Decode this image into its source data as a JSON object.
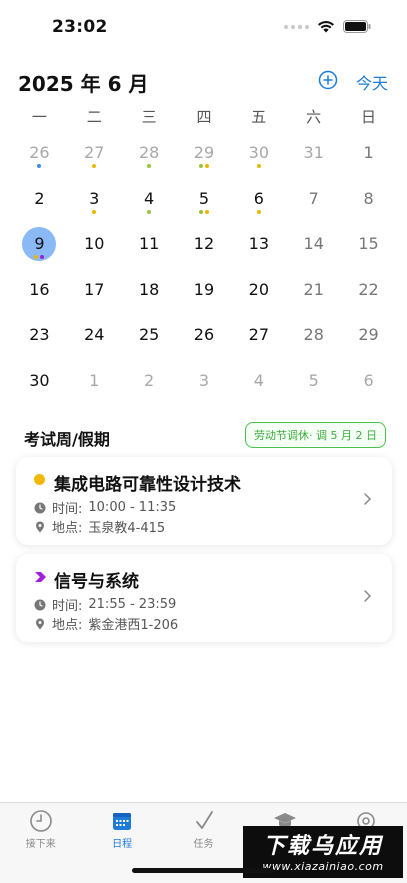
{
  "status_bar": {
    "time": "23:02"
  },
  "header": {
    "month_title": "2025 年 6 月",
    "today_label": "今天"
  },
  "weekdays": [
    "一",
    "二",
    "三",
    "四",
    "五",
    "六",
    "日"
  ],
  "calendar": {
    "selected_day": "9",
    "days": [
      {
        "d": "26",
        "other": true,
        "dots": [
          "#3a8ee6"
        ]
      },
      {
        "d": "27",
        "other": true,
        "dots": [
          "#e8b800"
        ]
      },
      {
        "d": "28",
        "other": true,
        "dots": [
          "#9bc23a"
        ]
      },
      {
        "d": "29",
        "other": true,
        "dots": [
          "#9bc23a",
          "#e8b800"
        ]
      },
      {
        "d": "30",
        "other": true,
        "dots": [
          "#e8b800"
        ]
      },
      {
        "d": "31",
        "other": true,
        "dots": []
      },
      {
        "d": "1",
        "other": false,
        "weekend": true,
        "dots": []
      },
      {
        "d": "2",
        "dots": []
      },
      {
        "d": "3",
        "dots": [
          "#e8b800"
        ]
      },
      {
        "d": "4",
        "dots": [
          "#9bc23a"
        ]
      },
      {
        "d": "5",
        "dots": [
          "#9bc23a",
          "#e8b800"
        ]
      },
      {
        "d": "6",
        "dots": [
          "#e8b800"
        ]
      },
      {
        "d": "7",
        "weekend": true,
        "dots": []
      },
      {
        "d": "8",
        "weekend": true,
        "dots": []
      },
      {
        "d": "9",
        "selected": true,
        "dots": [
          "#e8b800",
          "#a020d8"
        ]
      },
      {
        "d": "10",
        "dots": []
      },
      {
        "d": "11",
        "dots": []
      },
      {
        "d": "12",
        "dots": []
      },
      {
        "d": "13",
        "dots": []
      },
      {
        "d": "14",
        "weekend": true,
        "dots": []
      },
      {
        "d": "15",
        "weekend": true,
        "dots": []
      },
      {
        "d": "16",
        "dots": []
      },
      {
        "d": "17",
        "dots": []
      },
      {
        "d": "18",
        "dots": []
      },
      {
        "d": "19",
        "dots": []
      },
      {
        "d": "20",
        "dots": []
      },
      {
        "d": "21",
        "weekend": true,
        "dots": []
      },
      {
        "d": "22",
        "weekend": true,
        "dots": []
      },
      {
        "d": "23",
        "dots": []
      },
      {
        "d": "24",
        "dots": []
      },
      {
        "d": "25",
        "dots": []
      },
      {
        "d": "26",
        "dots": []
      },
      {
        "d": "27",
        "dots": []
      },
      {
        "d": "28",
        "weekend": true,
        "dots": []
      },
      {
        "d": "29",
        "weekend": true,
        "dots": []
      },
      {
        "d": "30",
        "dots": []
      },
      {
        "d": "1",
        "other": true,
        "dots": []
      },
      {
        "d": "2",
        "other": true,
        "dots": []
      },
      {
        "d": "3",
        "other": true,
        "dots": []
      },
      {
        "d": "4",
        "other": true,
        "dots": []
      },
      {
        "d": "5",
        "other": true,
        "dots": []
      },
      {
        "d": "6",
        "other": true,
        "dots": []
      }
    ]
  },
  "exam_section": {
    "title": "考试周/假期",
    "holiday_badge": "劳动节调休· 调 5 月 2 日"
  },
  "events": [
    {
      "title": "集成电路可靠性设计技术",
      "marker": "circle",
      "color": "#f2b705",
      "time_label": "时间:",
      "time": "10:00 - 11:35",
      "place_label": "地点:",
      "place": "玉泉教4-415"
    },
    {
      "title": "信号与系统",
      "marker": "arrow",
      "color": "#a020d8",
      "time_label": "时间:",
      "time": "21:55 - 23:59",
      "place_label": "地点:",
      "place": "紫金港西1-206"
    }
  ],
  "tabs": [
    {
      "label": "接下来",
      "icon": "clock-icon",
      "active": false
    },
    {
      "label": "日程",
      "icon": "calendar-icon",
      "active": true
    },
    {
      "label": "任务",
      "icon": "checkmark-icon",
      "active": false
    },
    {
      "label": "",
      "icon": "graduation-cap-icon",
      "active": false
    },
    {
      "label": "",
      "icon": "settings-icon",
      "active": false
    }
  ],
  "watermark": {
    "main": "下载乌应用",
    "sub": "www.xiazainiao.com"
  },
  "colors": {
    "accent": "#1e7bd8",
    "selected_day": "#8ab9f6",
    "holiday_green": "#3cac3c"
  }
}
